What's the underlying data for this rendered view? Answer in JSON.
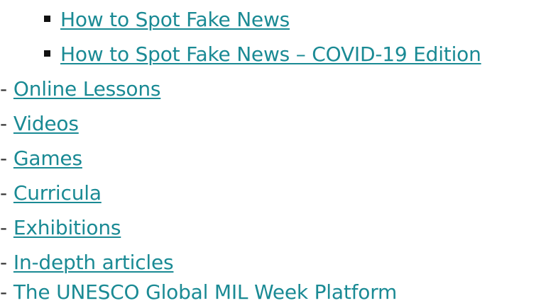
{
  "sub_list": [
    {
      "label": "How to Spot Fake News "
    },
    {
      "label": "How to Spot Fake News – COVID-19 Edition"
    }
  ],
  "dash_symbol": "-",
  "main_list": [
    {
      "label": "Online Lessons"
    },
    {
      "label": "Videos"
    },
    {
      "label": "Games "
    },
    {
      "label": "Curricula "
    },
    {
      "label": "Exhibitions"
    },
    {
      "label": "In-depth articles "
    },
    {
      "label": "The UNESCO Global MIL Week Platform"
    }
  ],
  "colors": {
    "link": "#1a8a94",
    "text": "#333333",
    "bullet": "#111111"
  }
}
